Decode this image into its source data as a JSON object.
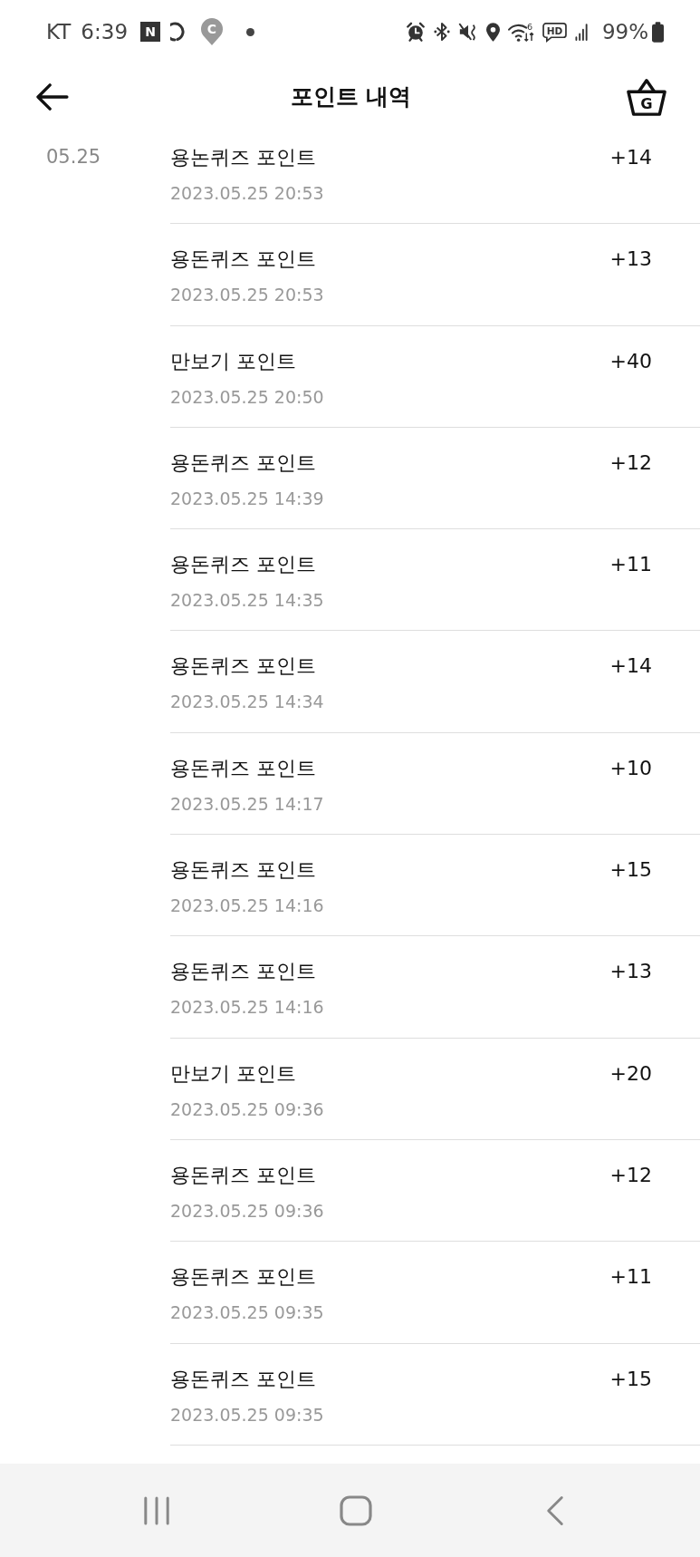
{
  "status_bar": {
    "carrier": "KT",
    "time": "6:39",
    "notifications": [
      {
        "kind": "tile",
        "letter": "N"
      },
      {
        "kind": "ring"
      },
      {
        "kind": "pin",
        "letter": "C"
      },
      {
        "kind": "dot"
      }
    ],
    "wifi_label": "6",
    "hd_label": "HD",
    "battery": "99%"
  },
  "header": {
    "title": "포인트 내역",
    "cart_letter": "G"
  },
  "history": [
    {
      "date": "05.25",
      "entries": [
        {
          "title": "용논퀴즈 포인트",
          "datetime": "2023.05.25 20:53",
          "amount": "+14"
        },
        {
          "title": "용돈퀴즈 포인트",
          "datetime": "2023.05.25 20:53",
          "amount": "+13"
        },
        {
          "title": "만보기 포인트",
          "datetime": "2023.05.25 20:50",
          "amount": "+40"
        },
        {
          "title": "용돈퀴즈 포인트",
          "datetime": "2023.05.25 14:39",
          "amount": "+12"
        },
        {
          "title": "용돈퀴즈 포인트",
          "datetime": "2023.05.25 14:35",
          "amount": "+11"
        },
        {
          "title": "용돈퀴즈 포인트",
          "datetime": "2023.05.25 14:34",
          "amount": "+14"
        },
        {
          "title": "용돈퀴즈 포인트",
          "datetime": "2023.05.25 14:17",
          "amount": "+10"
        },
        {
          "title": "용돈퀴즈 포인트",
          "datetime": "2023.05.25 14:16",
          "amount": "+15"
        },
        {
          "title": "용돈퀴즈 포인트",
          "datetime": "2023.05.25 14:16",
          "amount": "+13"
        },
        {
          "title": "만보기 포인트",
          "datetime": "2023.05.25 09:36",
          "amount": "+20"
        },
        {
          "title": "용돈퀴즈 포인트",
          "datetime": "2023.05.25 09:36",
          "amount": "+12"
        },
        {
          "title": "용돈퀴즈 포인트",
          "datetime": "2023.05.25 09:35",
          "amount": "+11"
        },
        {
          "title": "용돈퀴즈 포인트",
          "datetime": "2023.05.25 09:35",
          "amount": "+15"
        }
      ]
    }
  ]
}
